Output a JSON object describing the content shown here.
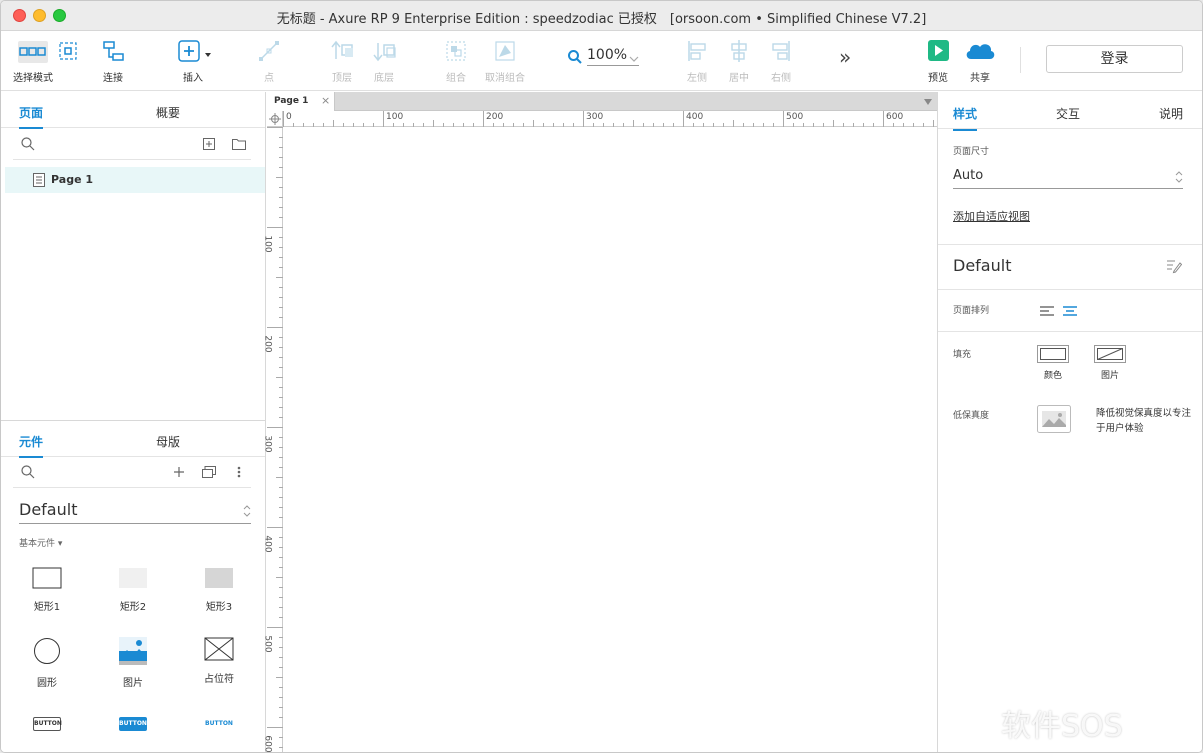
{
  "window": {
    "title": "无标题 - Axure RP 9 Enterprise Edition : speedzodiac 已授权　[orsoon.com • Simplified Chinese V7.2]"
  },
  "toolbar": {
    "select_mode": "选择模式",
    "connect": "连接",
    "insert": "插入",
    "point": "点",
    "top_layer": "顶层",
    "bottom_layer": "底层",
    "group": "组合",
    "ungroup": "取消组合",
    "zoom": "100%",
    "align_left": "左侧",
    "align_center": "居中",
    "align_right": "右侧",
    "more": "»",
    "preview": "预览",
    "share": "共享",
    "login": "登录"
  },
  "pages_panel": {
    "tabs": [
      "页面",
      "概要"
    ],
    "pages": [
      "Page 1"
    ]
  },
  "library_panel": {
    "tabs": [
      "元件",
      "母版"
    ],
    "library": "Default",
    "category": "基本元件 ▾",
    "widgets": [
      {
        "label": "矩形1"
      },
      {
        "label": "矩形2"
      },
      {
        "label": "矩形3"
      },
      {
        "label": "圆形"
      },
      {
        "label": "图片"
      },
      {
        "label": "占位符"
      },
      {
        "label": "BUTTON"
      },
      {
        "label": "BUTTON"
      },
      {
        "label": "BUTTON"
      }
    ]
  },
  "canvas": {
    "tab": "Page 1",
    "ruler_h": [
      "0",
      "100",
      "200",
      "300",
      "400",
      "500",
      "600"
    ],
    "ruler_v": [
      "100",
      "200",
      "300",
      "400",
      "500",
      "600"
    ]
  },
  "style_panel": {
    "tabs": [
      "样式",
      "交互",
      "说明"
    ],
    "page_size_label": "页面尺寸",
    "page_size_value": "Auto",
    "adaptive_link": "添加自适应视图",
    "style_name": "Default",
    "page_align_label": "页面排列",
    "fill_label": "填充",
    "fill_color": "颜色",
    "fill_image": "图片",
    "low_fidelity_label": "低保真度",
    "low_fidelity_desc_1": "降低视觉保真度以专注",
    "low_fidelity_desc_2": "于用户体验"
  },
  "watermark": "软件SOS",
  "colors": {
    "accent": "#1a8ad3",
    "preview_green": "#1fb985",
    "share_blue": "#1a8ad3",
    "selected_page_bg": "#e8f7f8"
  }
}
